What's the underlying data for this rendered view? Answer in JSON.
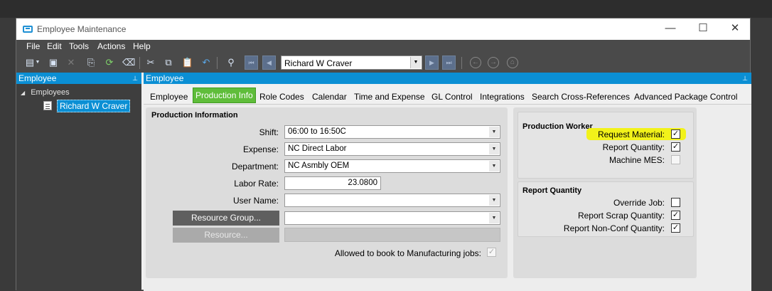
{
  "window": {
    "title": "Employee Maintenance",
    "minimize": "—",
    "maximize": "☐",
    "close": "✕"
  },
  "menu": [
    "File",
    "Edit",
    "Tools",
    "Actions",
    "Help"
  ],
  "toolbar": {
    "current_record": "Richard W Craver"
  },
  "left_panel": {
    "header": "Employee",
    "tree_root": "Employees",
    "tree_child": "Richard W Craver"
  },
  "main_panel": {
    "header": "Employee"
  },
  "tabs": [
    "Employee",
    "Production Info",
    "Role Codes",
    "Calendar",
    "Time and Expense",
    "GL Control",
    "Integrations",
    "Search Cross-References",
    "Advanced Package Control"
  ],
  "active_tab": "Production Info",
  "production_info": {
    "title": "Production Information",
    "shift": {
      "label": "Shift:",
      "value": "06:00 to 16:50C"
    },
    "expense": {
      "label": "Expense:",
      "value": "NC Direct Labor"
    },
    "department": {
      "label": "Department:",
      "value": "NC Asmbly OEM"
    },
    "labor_rate": {
      "label": "Labor Rate:",
      "value": "23.0800"
    },
    "user_name": {
      "label": "User Name:",
      "value": ""
    },
    "resource_group_button": "Resource Group...",
    "resource_button": "Resource...",
    "allowed_mfg": {
      "label": "Allowed to book to Manufacturing jobs:",
      "checked": true
    }
  },
  "production_worker": {
    "title": "Production Worker",
    "request_material": {
      "label": "Request Material:",
      "checked": true
    },
    "report_quantity": {
      "label": "Report Quantity:",
      "checked": true
    },
    "machine_mes": {
      "label": "Machine MES:",
      "checked": false
    }
  },
  "report_quantity": {
    "title": "Report Quantity",
    "override_job": {
      "label": "Override Job:",
      "checked": false
    },
    "report_scrap": {
      "label": "Report Scrap Quantity:",
      "checked": true
    },
    "report_nonconf": {
      "label": "Report Non-Conf Quantity:",
      "checked": true
    }
  },
  "colors": {
    "accent": "#0b8fd4",
    "active_tab": "#5fbd3a",
    "highlight": "#f2f21a",
    "dark_chrome": "#4a4a4a"
  },
  "checkmark": "✓",
  "dropdown_arrow": "▼"
}
